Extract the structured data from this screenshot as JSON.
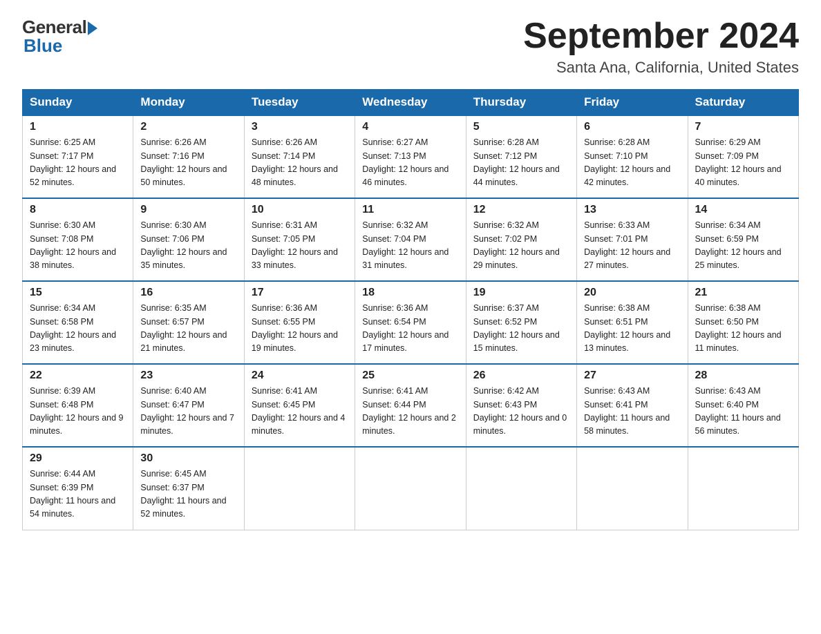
{
  "header": {
    "logo_general": "General",
    "logo_blue": "Blue",
    "month_title": "September 2024",
    "location": "Santa Ana, California, United States"
  },
  "weekdays": [
    "Sunday",
    "Monday",
    "Tuesday",
    "Wednesday",
    "Thursday",
    "Friday",
    "Saturday"
  ],
  "weeks": [
    [
      {
        "day": "1",
        "sunrise": "6:25 AM",
        "sunset": "7:17 PM",
        "daylight": "12 hours and 52 minutes."
      },
      {
        "day": "2",
        "sunrise": "6:26 AM",
        "sunset": "7:16 PM",
        "daylight": "12 hours and 50 minutes."
      },
      {
        "day": "3",
        "sunrise": "6:26 AM",
        "sunset": "7:14 PM",
        "daylight": "12 hours and 48 minutes."
      },
      {
        "day": "4",
        "sunrise": "6:27 AM",
        "sunset": "7:13 PM",
        "daylight": "12 hours and 46 minutes."
      },
      {
        "day": "5",
        "sunrise": "6:28 AM",
        "sunset": "7:12 PM",
        "daylight": "12 hours and 44 minutes."
      },
      {
        "day": "6",
        "sunrise": "6:28 AM",
        "sunset": "7:10 PM",
        "daylight": "12 hours and 42 minutes."
      },
      {
        "day": "7",
        "sunrise": "6:29 AM",
        "sunset": "7:09 PM",
        "daylight": "12 hours and 40 minutes."
      }
    ],
    [
      {
        "day": "8",
        "sunrise": "6:30 AM",
        "sunset": "7:08 PM",
        "daylight": "12 hours and 38 minutes."
      },
      {
        "day": "9",
        "sunrise": "6:30 AM",
        "sunset": "7:06 PM",
        "daylight": "12 hours and 35 minutes."
      },
      {
        "day": "10",
        "sunrise": "6:31 AM",
        "sunset": "7:05 PM",
        "daylight": "12 hours and 33 minutes."
      },
      {
        "day": "11",
        "sunrise": "6:32 AM",
        "sunset": "7:04 PM",
        "daylight": "12 hours and 31 minutes."
      },
      {
        "day": "12",
        "sunrise": "6:32 AM",
        "sunset": "7:02 PM",
        "daylight": "12 hours and 29 minutes."
      },
      {
        "day": "13",
        "sunrise": "6:33 AM",
        "sunset": "7:01 PM",
        "daylight": "12 hours and 27 minutes."
      },
      {
        "day": "14",
        "sunrise": "6:34 AM",
        "sunset": "6:59 PM",
        "daylight": "12 hours and 25 minutes."
      }
    ],
    [
      {
        "day": "15",
        "sunrise": "6:34 AM",
        "sunset": "6:58 PM",
        "daylight": "12 hours and 23 minutes."
      },
      {
        "day": "16",
        "sunrise": "6:35 AM",
        "sunset": "6:57 PM",
        "daylight": "12 hours and 21 minutes."
      },
      {
        "day": "17",
        "sunrise": "6:36 AM",
        "sunset": "6:55 PM",
        "daylight": "12 hours and 19 minutes."
      },
      {
        "day": "18",
        "sunrise": "6:36 AM",
        "sunset": "6:54 PM",
        "daylight": "12 hours and 17 minutes."
      },
      {
        "day": "19",
        "sunrise": "6:37 AM",
        "sunset": "6:52 PM",
        "daylight": "12 hours and 15 minutes."
      },
      {
        "day": "20",
        "sunrise": "6:38 AM",
        "sunset": "6:51 PM",
        "daylight": "12 hours and 13 minutes."
      },
      {
        "day": "21",
        "sunrise": "6:38 AM",
        "sunset": "6:50 PM",
        "daylight": "12 hours and 11 minutes."
      }
    ],
    [
      {
        "day": "22",
        "sunrise": "6:39 AM",
        "sunset": "6:48 PM",
        "daylight": "12 hours and 9 minutes."
      },
      {
        "day": "23",
        "sunrise": "6:40 AM",
        "sunset": "6:47 PM",
        "daylight": "12 hours and 7 minutes."
      },
      {
        "day": "24",
        "sunrise": "6:41 AM",
        "sunset": "6:45 PM",
        "daylight": "12 hours and 4 minutes."
      },
      {
        "day": "25",
        "sunrise": "6:41 AM",
        "sunset": "6:44 PM",
        "daylight": "12 hours and 2 minutes."
      },
      {
        "day": "26",
        "sunrise": "6:42 AM",
        "sunset": "6:43 PM",
        "daylight": "12 hours and 0 minutes."
      },
      {
        "day": "27",
        "sunrise": "6:43 AM",
        "sunset": "6:41 PM",
        "daylight": "11 hours and 58 minutes."
      },
      {
        "day": "28",
        "sunrise": "6:43 AM",
        "sunset": "6:40 PM",
        "daylight": "11 hours and 56 minutes."
      }
    ],
    [
      {
        "day": "29",
        "sunrise": "6:44 AM",
        "sunset": "6:39 PM",
        "daylight": "11 hours and 54 minutes."
      },
      {
        "day": "30",
        "sunrise": "6:45 AM",
        "sunset": "6:37 PM",
        "daylight": "11 hours and 52 minutes."
      },
      null,
      null,
      null,
      null,
      null
    ]
  ]
}
